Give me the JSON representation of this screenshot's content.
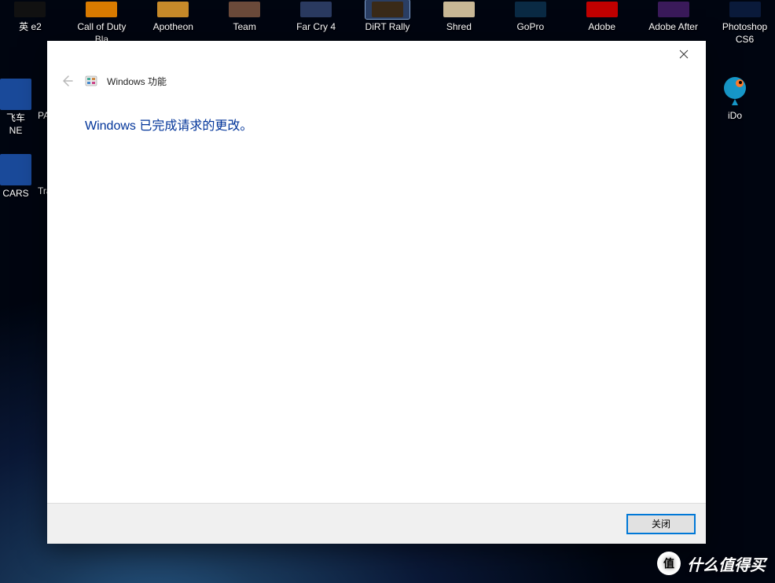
{
  "desktop": {
    "top_row": [
      {
        "label": "英\ne2",
        "color": "#111"
      },
      {
        "label": "Call of Duty Bla",
        "color": "#d97b00"
      },
      {
        "label": "Apotheon",
        "color": "#c78a2a"
      },
      {
        "label": "Team",
        "color": "#6b4a3a"
      },
      {
        "label": "Far Cry 4",
        "color": "#2a3a60"
      },
      {
        "label": "DiRT Rally",
        "color": "#3a2a18",
        "selected": true
      },
      {
        "label": "Shred",
        "color": "#c9b896"
      },
      {
        "label": "GoPro",
        "color": "#0a2a44"
      },
      {
        "label": "Adobe",
        "color": "#c00000"
      },
      {
        "label": "Adobe After",
        "color": "#3a1a5a"
      },
      {
        "label": "Photoshop CS6",
        "color": "#0a1a3a"
      }
    ],
    "left_col": [
      {
        "label": "飞车\nNE",
        "extra": "PA",
        "color": "#1a4a9a"
      },
      {
        "label": "CARS",
        "extra": "Tra",
        "color": "#1a4a9a"
      }
    ],
    "right_icon": {
      "label": "iDo",
      "color": "#1798c9"
    }
  },
  "dialog": {
    "title": "Windows 功能",
    "message": "Windows 已完成请求的更改。",
    "close_button": "关闭"
  },
  "watermark": {
    "badge": "值",
    "text": "什么值得买"
  }
}
